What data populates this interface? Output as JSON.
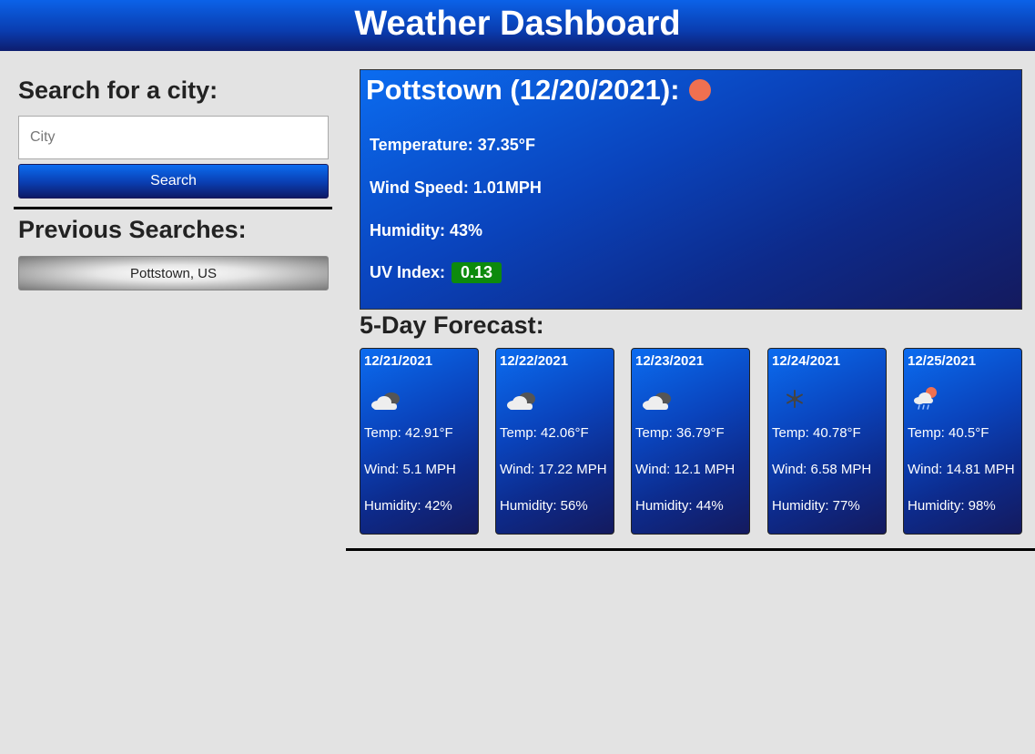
{
  "header": {
    "title": "Weather Dashboard"
  },
  "search": {
    "heading": "Search for a city:",
    "placeholder": "City",
    "value": "",
    "button_label": "Search"
  },
  "history": {
    "heading": "Previous Searches:",
    "items": [
      {
        "label": "Pottstown, US"
      }
    ]
  },
  "current": {
    "title": "Pottstown (12/20/2021):",
    "icon": "sun-icon",
    "icon_color": "#f07050",
    "temperature": "Temperature: 37.35°F",
    "wind": "Wind Speed: 1.01MPH",
    "humidity": "Humidity: 43%",
    "uv_label": "UV Index:",
    "uv_value": "0.13",
    "uv_color": "#0d8a0d"
  },
  "forecast": {
    "heading": "5-Day Forecast:",
    "days": [
      {
        "date": "12/21/2021",
        "icon": "cloudy-icon",
        "temp": "Temp: 42.91°F",
        "wind": "Wind: 5.1 MPH",
        "humidity": "Humidity: 42%"
      },
      {
        "date": "12/22/2021",
        "icon": "cloudy-icon",
        "temp": "Temp: 42.06°F",
        "wind": "Wind: 17.22 MPH",
        "humidity": "Humidity: 56%"
      },
      {
        "date": "12/23/2021",
        "icon": "cloudy-icon",
        "temp": "Temp: 36.79°F",
        "wind": "Wind: 12.1 MPH",
        "humidity": "Humidity: 44%"
      },
      {
        "date": "12/24/2021",
        "icon": "snow-icon",
        "temp": "Temp: 40.78°F",
        "wind": "Wind: 6.58 MPH",
        "humidity": "Humidity: 77%"
      },
      {
        "date": "12/25/2021",
        "icon": "rain-sun-icon",
        "temp": "Temp: 40.5°F",
        "wind": "Wind: 14.81 MPH",
        "humidity": "Humidity: 98%"
      }
    ]
  }
}
